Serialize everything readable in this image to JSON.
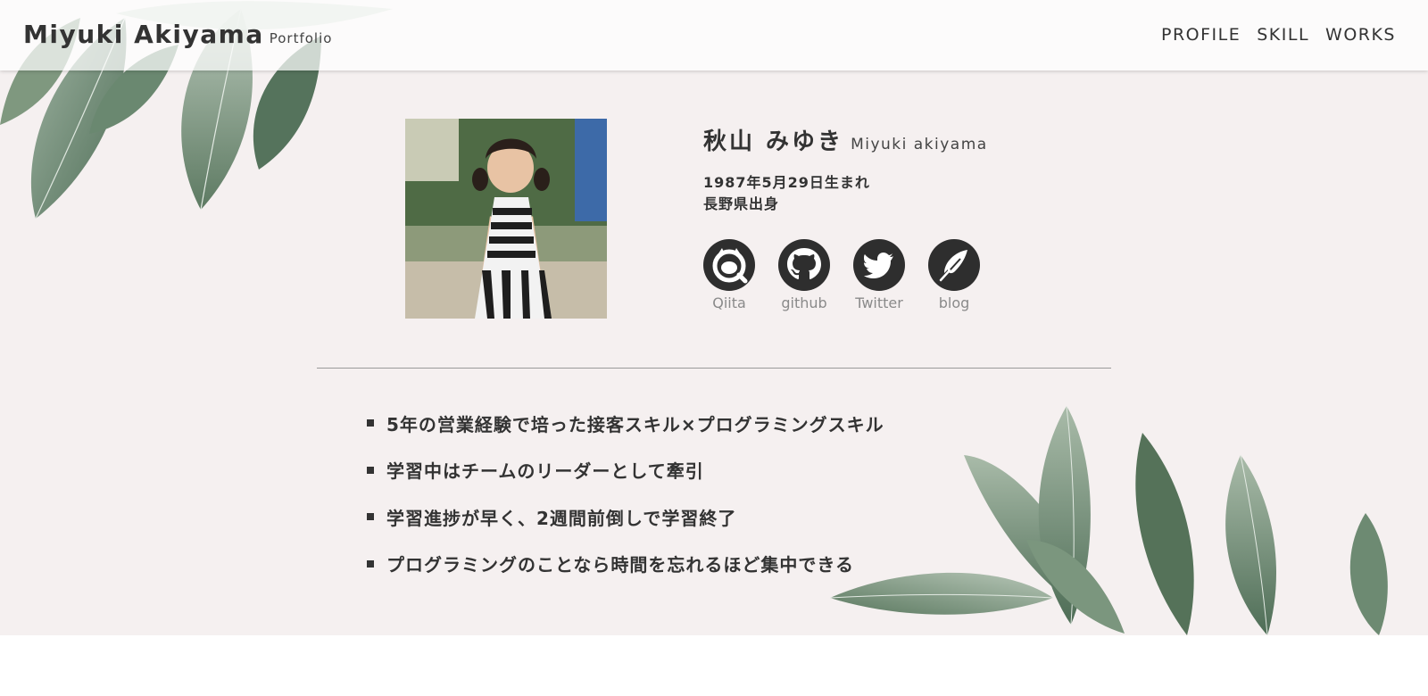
{
  "header": {
    "name": "Miyuki Akiyama",
    "sub": "Portfolio",
    "nav": [
      {
        "label": "PROFILE"
      },
      {
        "label": "SKILL"
      },
      {
        "label": "WORKS"
      }
    ]
  },
  "profile": {
    "name_jp": "秋山 みゆき",
    "name_en": "Miyuki akiyama",
    "birth": "1987年5月29日生まれ",
    "origin": "長野県出身",
    "socials": [
      {
        "label": "Qiita",
        "icon": "qiita-icon"
      },
      {
        "label": "github",
        "icon": "github-icon"
      },
      {
        "label": "Twitter",
        "icon": "twitter-icon"
      },
      {
        "label": "blog",
        "icon": "feather-icon"
      }
    ]
  },
  "highlights": [
    "5年の営業経験で培った接客スキル×プログラミングスキル",
    "学習中はチームのリーダーとして牽引",
    "学習進捗が早く、2週間前倒しで学習終了",
    "プログラミングのことなら時間を忘れるほど集中できる"
  ],
  "colors": {
    "background": "#f5f0f0",
    "text": "#333333",
    "icon": "#2e2e2e",
    "leaf": "#6e8a73"
  }
}
